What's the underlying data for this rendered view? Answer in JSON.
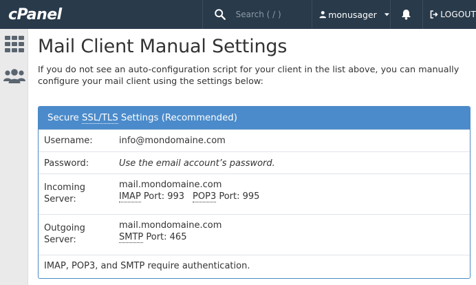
{
  "topbar": {
    "logo_text": "cPanel",
    "search_placeholder": "Search ( / )",
    "username": "monusager",
    "logout_label": "LOGOUT"
  },
  "sidebar": {
    "items": [
      {
        "icon": "grid-icon"
      },
      {
        "icon": "users-icon"
      }
    ]
  },
  "page": {
    "title": "Mail Client Manual Settings",
    "intro": "If you do not see an auto-configuration script for your client in the list above, you can manually configure your mail client using the settings below:"
  },
  "panel": {
    "heading_abbr": "SSL/TLS",
    "heading_prefix": "Secure ",
    "heading_suffix": " Settings (Recommended)",
    "username_label": "Username:",
    "username_value": "info@mondomaine.com",
    "password_label": "Password:",
    "password_value": "Use the email account’s password.",
    "incoming_label_1": "Incoming",
    "incoming_label_2": "Server:",
    "incoming_server": "mail.mondomaine.com",
    "imap_label": "IMAP",
    "imap_port_text": " Port: 993",
    "pop3_label": "POP3",
    "pop3_port_text": " Port: 995",
    "outgoing_label_1": "Outgoing",
    "outgoing_label_2": "Server:",
    "outgoing_server": "mail.mondomaine.com",
    "smtp_label": "SMTP",
    "smtp_port_text": " Port: 465",
    "auth_note": "IMAP, POP3, and SMTP require authentication."
  },
  "colors": {
    "topbar_bg": "#293a4a",
    "panel_header_bg": "#4b8bcb",
    "sidebar_bg": "#eaeaea"
  }
}
